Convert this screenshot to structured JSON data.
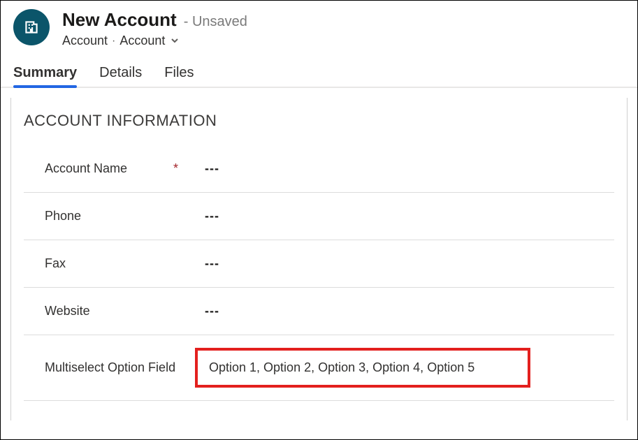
{
  "header": {
    "title": "New Account",
    "status_prefix": "- ",
    "status": "Unsaved",
    "entity_label": "Account",
    "form_selector": "Account"
  },
  "tabs": [
    {
      "id": "summary",
      "label": "Summary",
      "active": true
    },
    {
      "id": "details",
      "label": "Details",
      "active": false
    },
    {
      "id": "files",
      "label": "Files",
      "active": false
    }
  ],
  "section": {
    "title": "ACCOUNT INFORMATION"
  },
  "fields": {
    "account_name": {
      "label": "Account Name",
      "required": true,
      "value": "---"
    },
    "phone": {
      "label": "Phone",
      "required": false,
      "value": "---"
    },
    "fax": {
      "label": "Fax",
      "required": false,
      "value": "---"
    },
    "website": {
      "label": "Website",
      "required": false,
      "value": "---"
    },
    "multiselect": {
      "label": "Multiselect Option Field",
      "required": false,
      "value": "Option 1, Option 2, Option 3, Option 4, Option 5"
    }
  }
}
